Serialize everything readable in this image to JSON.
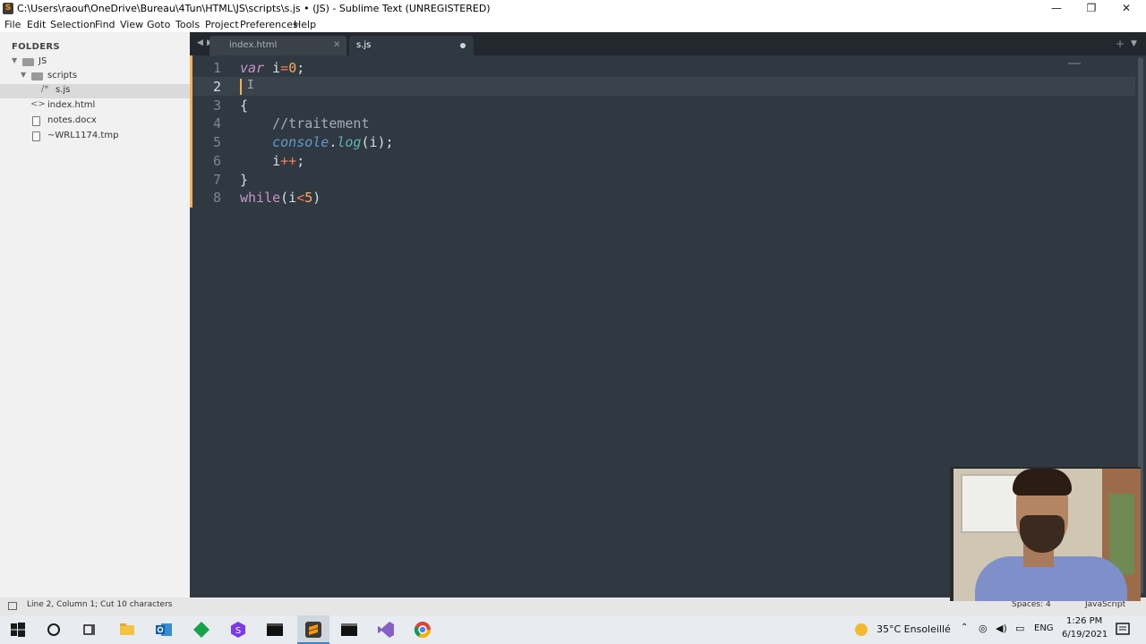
{
  "window": {
    "title": "C:\\Users\\raouf\\OneDrive\\Bureau\\4Tun\\HTML\\JS\\scripts\\s.js • (JS) - Sublime Text (UNREGISTERED)",
    "minimize": "—",
    "restore": "❐",
    "close": "✕"
  },
  "menu": [
    "File",
    "Edit",
    "Selection",
    "Find",
    "View",
    "Goto",
    "Tools",
    "Project",
    "Preferences",
    "Help"
  ],
  "sidebar": {
    "header": "FOLDERS",
    "items": [
      {
        "label": "JS",
        "type": "folder",
        "expanded": true
      },
      {
        "label": "scripts",
        "type": "folder",
        "expanded": true
      },
      {
        "label": "s.js",
        "type": "file-js",
        "selected": true
      },
      {
        "label": "index.html",
        "type": "file-code"
      },
      {
        "label": "notes.docx",
        "type": "file"
      },
      {
        "label": "~WRL1174.tmp",
        "type": "file"
      }
    ]
  },
  "tabs": [
    {
      "label": "index.html",
      "active": false,
      "modified": false
    },
    {
      "label": "s.js",
      "active": true,
      "modified": true
    }
  ],
  "tabbar": {
    "nav_prev": "◀",
    "nav_next": "▶",
    "new_tab": "+",
    "tab_menu": "▼"
  },
  "editor": {
    "line_numbers": [
      "1",
      "2",
      "3",
      "4",
      "5",
      "6",
      "7",
      "8"
    ],
    "active_line": 2,
    "code": {
      "l1_kw": "var",
      "l1_var": " i",
      "l1_op": "=",
      "l1_num": "0",
      "l1_end": ";",
      "l3": "{",
      "l4": "    //traitement",
      "l5_indent": "    ",
      "l5_obj": "console",
      "l5_dot": ".",
      "l5_fn": "log",
      "l5_args": "(i);",
      "l6_indent": "    ",
      "l6_var": "i",
      "l6_op": "++",
      "l6_end": ";",
      "l7": "}",
      "l8_kw": "while",
      "l8_open": "(i",
      "l8_op": "<",
      "l8_num": "5",
      "l8_close": ")"
    }
  },
  "status": {
    "message": "Line 2, Column 1; Cut 10 characters",
    "spaces": "Spaces: 4",
    "syntax": "JavaScript"
  },
  "taskbar": {
    "weather": "35°C  Ensoleillé",
    "language": "ENG",
    "time": "1:26 PM",
    "date": "6/19/2021"
  },
  "colors": {
    "editor_bg": "#303841",
    "accent_orange": "#f9ae58",
    "keyword": "#c695c6",
    "function": "#5fb4b4",
    "comment": "#a6acb9"
  }
}
